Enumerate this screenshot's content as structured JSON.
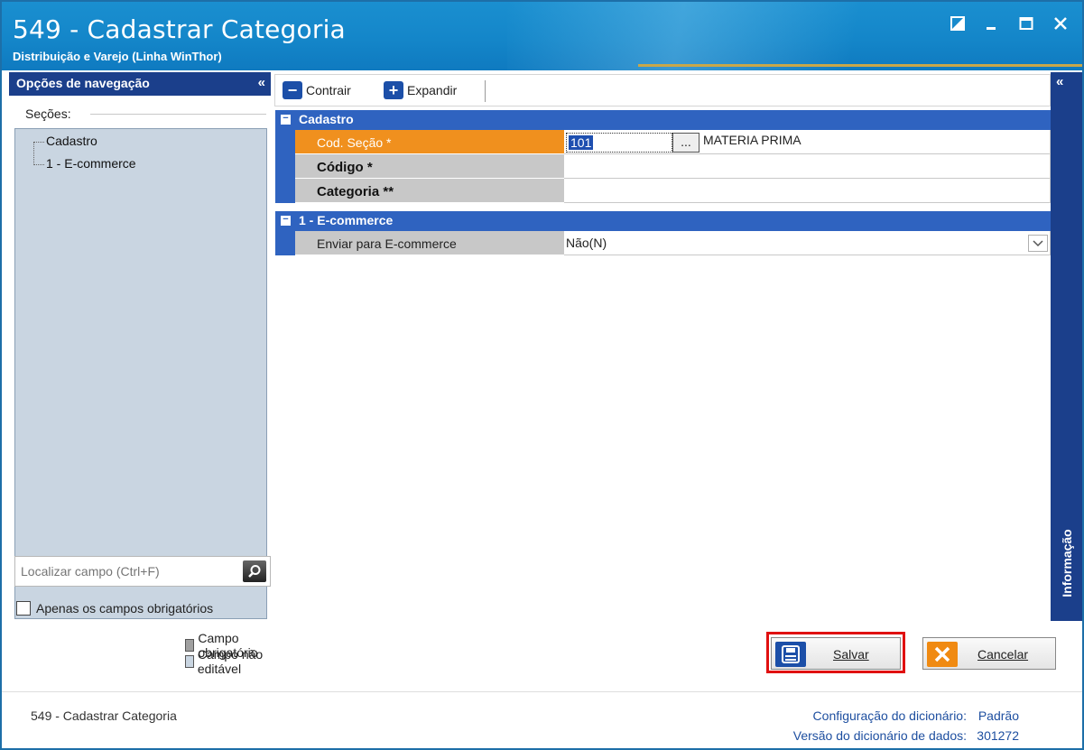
{
  "window": {
    "title": "549 - Cadastrar Categoria",
    "subtitle": "Distribuição e Varejo (Linha WinThor)"
  },
  "nav": {
    "header": "Opções de navegação",
    "collapse_icon": "«",
    "sections_label": "Seções:",
    "tree": [
      "Cadastro",
      "1 - E-commerce"
    ],
    "search_placeholder": "Localizar campo (Ctrl+F)",
    "only_required_label": "Apenas os campos obrigatórios",
    "legend": {
      "required": "Campo obrigatório",
      "not_editable": "Campo não editável"
    },
    "legend_colors": {
      "required": "#a0a0a0",
      "not_editable": "#c9d5e1"
    }
  },
  "toolbar": {
    "collapse_label": "Contrair",
    "expand_label": "Expandir"
  },
  "grid": {
    "categories": [
      {
        "label": "Cadastro",
        "rows": [
          {
            "name": "Cod. Seção *",
            "code": "101",
            "description": "MATERIA PRIMA",
            "button": "..."
          },
          {
            "name": "Código *",
            "value": ""
          },
          {
            "name": "Categoria **",
            "value": ""
          }
        ]
      },
      {
        "label": "1 - E-commerce",
        "rows": [
          {
            "name": "Enviar para E-commerce",
            "value": "Não(N)"
          }
        ]
      }
    ]
  },
  "rail": {
    "label": "Informação"
  },
  "actions": {
    "save_label": "Salvar",
    "cancel_label": "Cancelar"
  },
  "footer": {
    "left": "549 - Cadastrar Categoria",
    "config_label": "Configuração do dicionário:",
    "config_value": "Padrão",
    "version_label": "Versão do dicionário de dados:",
    "version_value": "301272"
  },
  "colors": {
    "titlebar": "#1486c9",
    "nav_header": "#1b3f8b",
    "category_row": "#2f63c0",
    "active_field": "#f0901e",
    "highlight": "#e01010"
  }
}
